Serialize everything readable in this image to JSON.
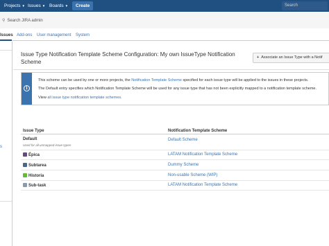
{
  "topnav": {
    "projects": "Projects",
    "issues": "Issues",
    "boards": "Boards",
    "create": "Create",
    "search_placeholder": "Search"
  },
  "admin": {
    "search_label": "Search JIRA admin",
    "tabs": [
      "Issues",
      "Add-ons",
      "User management",
      "System"
    ]
  },
  "sidebar": {
    "link": "s"
  },
  "page": {
    "title": "Issue Type Notification Template Scheme Configuration: My own IssueType Notification Scheme",
    "associate_button": "Associate an Issue Type with a Notif"
  },
  "info": {
    "line1_pre": "This scheme can be used by one or more projects, the ",
    "line1_link": "Notification Template Scheme",
    "line1_post": " specified for each issue type will be applied to the issues in these projects.",
    "line2": "The Default entry specifies which Notification Template Scheme will be used for any issue type that has not been explicitly mapped to a notification template scheme.",
    "line3_pre": "View ",
    "line3_link": "all issue type notification template schemes."
  },
  "table": {
    "headers": [
      "Issue Type",
      "Notification Template Scheme"
    ],
    "default_row": {
      "type": "Default",
      "sub": "Used for all unmapped issue types",
      "scheme": "Default Scheme"
    },
    "rows": [
      {
        "type": "Épica",
        "scheme": "LATAM Notification Template Scheme",
        "icon_color": "#654982"
      },
      {
        "type": "Subtarea",
        "scheme": "Dummy Scheme",
        "icon_color": "#4a6785"
      },
      {
        "type": "Historia",
        "scheme": "Non-usable Scheme (WIP)",
        "icon_color": "#63ba3c"
      },
      {
        "type": "Sub-task",
        "scheme": "LATAM Notification Template Scheme",
        "icon_color": "#8a9bb0"
      }
    ]
  },
  "colors": {
    "nav_bg": "#205081",
    "link": "#3b73af",
    "info_strip": "#3b73af"
  }
}
